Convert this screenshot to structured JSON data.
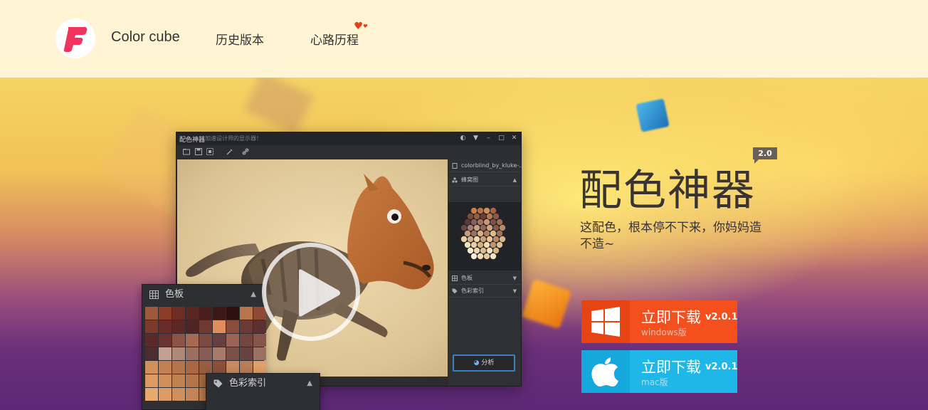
{
  "header": {
    "brand": "Color cube",
    "nav": [
      {
        "label": "历史版本"
      },
      {
        "label": "心路历程"
      }
    ]
  },
  "hero": {
    "title": "配色神器",
    "version_badge": "2.0",
    "slogan": "这配色，根本停不下来，你妈妈造不造~"
  },
  "downloads": [
    {
      "label": "立即下载",
      "version": "v2.0.1",
      "platform": "windows版",
      "color": "#f3501e",
      "icon": "windows-icon"
    },
    {
      "label": "立即下载",
      "version": "v2.0.1",
      "platform": "mac版",
      "color": "#1fb7e8",
      "icon": "apple-icon"
    }
  ],
  "app_screenshot": {
    "title": "配色神器",
    "subtitle": "加速设计师的显示器！",
    "side_panel": {
      "file": "colorblind_by_kluke-...",
      "honeycomb": "蜂窝图",
      "palette": "色板",
      "color_index": "色彩索引",
      "analyze": "分析"
    },
    "palette_panel_title": "色板",
    "index_panel_title": "色彩索引"
  },
  "colors": {
    "header_bg": "#fff4d3",
    "windows_button": "#f3501e",
    "mac_button": "#1fb7e8",
    "logo_red": "#f0345e"
  }
}
